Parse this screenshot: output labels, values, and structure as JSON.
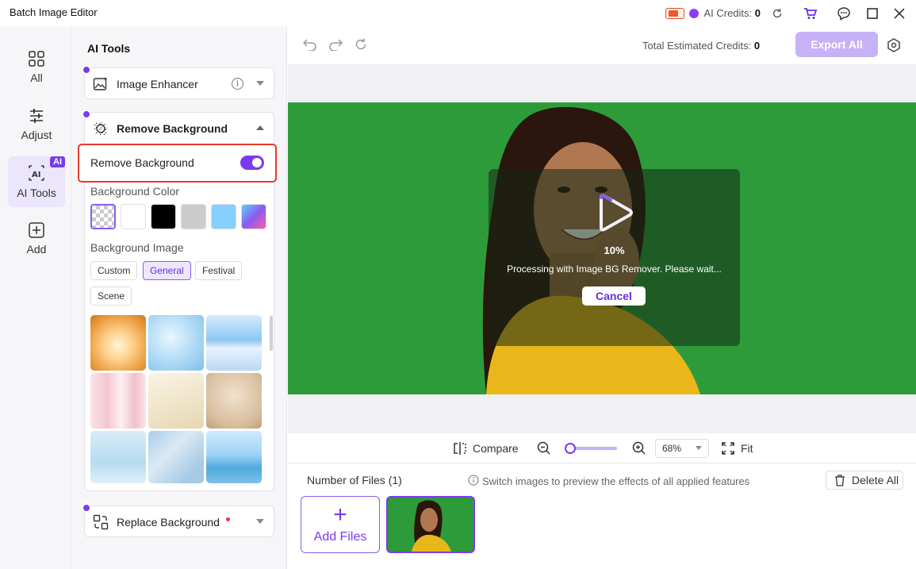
{
  "window": {
    "title": "Batch Image Editor"
  },
  "topbar": {
    "ai_credits_label": "AI Credits:",
    "ai_credits_value": "0"
  },
  "rail": {
    "items": [
      {
        "label": "All",
        "icon": "grid-icon"
      },
      {
        "label": "Adjust",
        "icon": "sliders-icon"
      },
      {
        "label": "AI Tools",
        "icon": "ai-tools-icon",
        "badge": "AI"
      },
      {
        "label": "Add",
        "icon": "plus-square-icon"
      }
    ]
  },
  "panel": {
    "title": "AI Tools",
    "image_enhancer": {
      "label": "Image Enhancer"
    },
    "remove_background": {
      "label": "Remove Background",
      "toggle_label": "Remove Background",
      "toggle_on": true,
      "bg_color_label": "Background Color",
      "colors": [
        "transparent",
        "#ffffff",
        "#000000",
        "#cccccc",
        "#85d0ff",
        "gradient"
      ],
      "bg_image_label": "Background Image",
      "categories": [
        "Custom",
        "General",
        "Festival",
        "Scene"
      ],
      "selected_category": "General"
    },
    "replace_background": {
      "label": "Replace Background"
    }
  },
  "editor": {
    "total_credits_label": "Total Estimated Credits:",
    "total_credits_value": "0",
    "export_label": "Export All",
    "progress_text": "10%",
    "progress_value": 0.1,
    "processing_text": "Processing with Image BG Remover. Please wait...",
    "cancel_label": "Cancel"
  },
  "zoombar": {
    "compare_label": "Compare",
    "zoom_value": "68%",
    "fit_label": "Fit"
  },
  "files": {
    "count_label": "Number of Files (1)",
    "hint": "Switch images to preview the effects of all applied features",
    "delete_label": "Delete All",
    "add_label": "Add Files"
  },
  "colors": {
    "accent": "#7a3bf0",
    "highlight": "#e53a2c",
    "green_bg": "#2e9b3a"
  }
}
